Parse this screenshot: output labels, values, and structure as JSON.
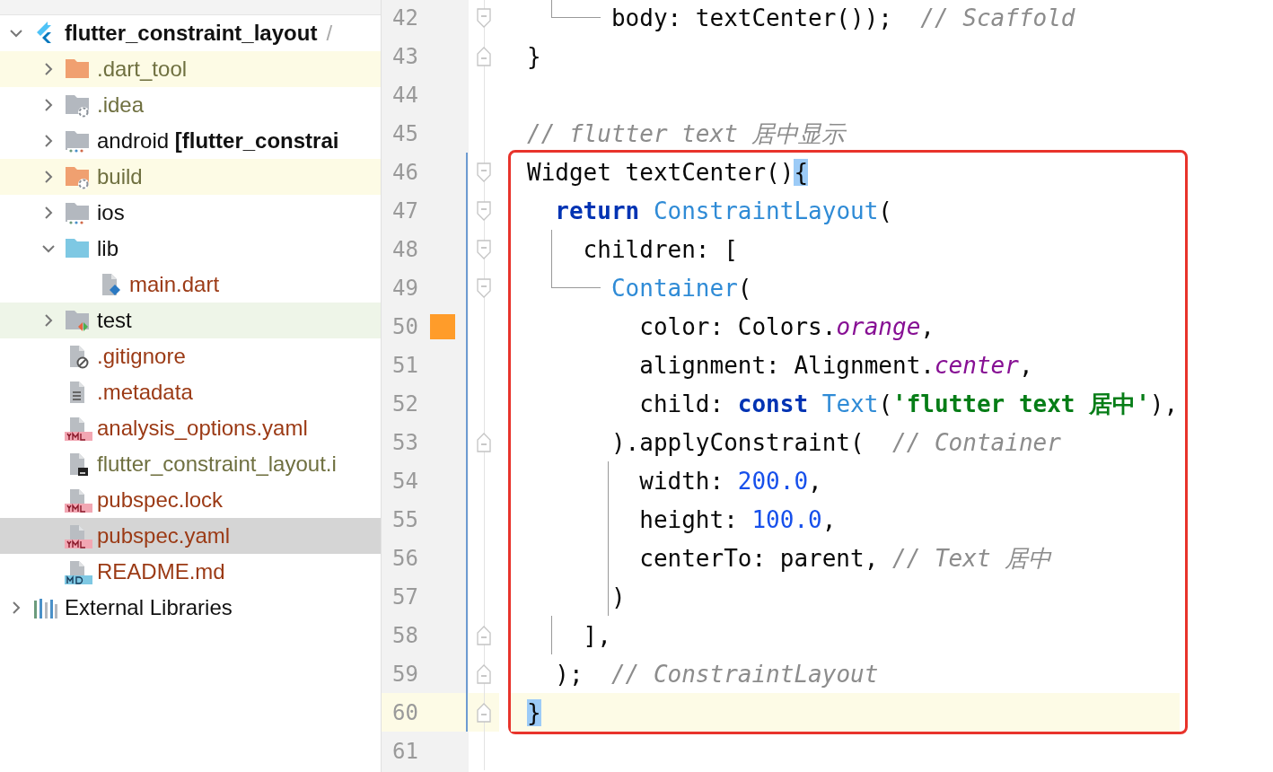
{
  "project_tree": {
    "items": [
      {
        "kind": "project",
        "label": "**flutter_constraint_layout**",
        "path": "/",
        "expanded": true,
        "selected": false,
        "children": [
          {
            "kind": "folder",
            "label": ".dart_tool",
            "excluded": true,
            "ignored": true,
            "expanded": false,
            "selected": false
          },
          {
            "kind": "config",
            "label": ".idea",
            "excluded": false,
            "ignored": true,
            "expanded": false,
            "selected": false
          },
          {
            "kind": "module",
            "label": "android **[flutter_constrai**",
            "excluded": false,
            "expanded": false,
            "selected": false
          },
          {
            "kind": "config",
            "label": "build",
            "excluded": true,
            "ignored": true,
            "expanded": false,
            "selected": false
          },
          {
            "kind": "module",
            "label": "ios",
            "excluded": false,
            "expanded": false,
            "selected": false
          },
          {
            "kind": "source",
            "label": "lib",
            "excluded": false,
            "expanded": true,
            "selected": false,
            "children": [
              {
                "kind": "dart",
                "label": "main.dart",
                "unversioned": true,
                "selected": false
              }
            ]
          },
          {
            "kind": "test",
            "label": "test",
            "excluded": false,
            "expanded": false,
            "selected": false
          },
          {
            "kind": "ignore",
            "label": ".gitignore",
            "unversioned": true,
            "selected": false
          },
          {
            "kind": "text",
            "label": ".metadata",
            "unversioned": true,
            "selected": false
          },
          {
            "kind": "yaml",
            "label": "analysis_options.yaml",
            "unversioned": true,
            "selected": false
          },
          {
            "kind": "iml",
            "label": "flutter_constraint_layout.i",
            "ignored": true,
            "selected": false
          },
          {
            "kind": "yaml",
            "label": "pubspec.lock",
            "unversioned": true,
            "selected": false
          },
          {
            "kind": "yaml",
            "label": "pubspec.yaml",
            "unversioned": true,
            "selected": true
          },
          {
            "kind": "markdown",
            "label": "README.md",
            "unversioned": true,
            "selected": false
          }
        ]
      },
      {
        "kind": "libraries",
        "label": "External Libraries",
        "expanded": false,
        "selected": false
      }
    ]
  },
  "editor": {
    "lines": [
      {
        "number": "42",
        "fold_start": true,
        "branch": true,
        "tokens": [
          {
            "kind": "plain",
            "text": "      body: textCenter());  "
          },
          {
            "kind": "comment",
            "text": "// Scaffold"
          }
        ]
      },
      {
        "number": "43",
        "fold_end": true,
        "tokens": [
          {
            "kind": "plain",
            "text": "}"
          }
        ]
      },
      {
        "number": "44"
      },
      {
        "number": "45",
        "tokens": [
          {
            "kind": "comment",
            "text": "// flutter text 居中显示"
          }
        ]
      },
      {
        "number": "46",
        "fold_start": true,
        "modified": true,
        "boxed": true,
        "tokens": [
          {
            "kind": "plain",
            "text": "Widget textCenter()"
          },
          {
            "kind": "brace",
            "text": "{"
          }
        ]
      },
      {
        "number": "47",
        "fold_start": true,
        "modified": true,
        "boxed": true,
        "tokens": [
          {
            "kind": "keyword",
            "text": "  return"
          },
          {
            "kind": "class",
            "text": " ConstraintLayout"
          },
          {
            "kind": "plain",
            "text": "("
          }
        ]
      },
      {
        "number": "48",
        "fold_start": true,
        "modified": true,
        "boxed": true,
        "outer_guide": true,
        "tokens": [
          {
            "kind": "plain",
            "text": "    children: ["
          }
        ]
      },
      {
        "number": "49",
        "fold_start": true,
        "modified": true,
        "boxed": true,
        "branch": true,
        "tokens": [
          {
            "kind": "class",
            "text": "      Container"
          },
          {
            "kind": "plain",
            "text": "("
          }
        ]
      },
      {
        "number": "50",
        "color": "#ff9c2a",
        "modified": true,
        "boxed": true,
        "tokens": [
          {
            "kind": "plain",
            "text": "        color: Colors."
          },
          {
            "kind": "field",
            "text": "orange"
          },
          {
            "kind": "plain",
            "text": ","
          }
        ]
      },
      {
        "number": "51",
        "modified": true,
        "boxed": true,
        "tokens": [
          {
            "kind": "plain",
            "text": "        alignment: Alignment."
          },
          {
            "kind": "field",
            "text": "center"
          },
          {
            "kind": "plain",
            "text": ","
          }
        ]
      },
      {
        "number": "52",
        "modified": true,
        "boxed": true,
        "tokens": [
          {
            "kind": "plain",
            "text": "        child: "
          },
          {
            "kind": "keyword",
            "text": "const"
          },
          {
            "kind": "class",
            "text": " Text"
          },
          {
            "kind": "plain",
            "text": "("
          },
          {
            "kind": "string",
            "text": "'flutter text 居中'"
          },
          {
            "kind": "plain",
            "text": "),"
          }
        ]
      },
      {
        "number": "53",
        "fold_end": true,
        "modified": true,
        "boxed": true,
        "tokens": [
          {
            "kind": "plain",
            "text": "      ).applyConstraint(  "
          },
          {
            "kind": "comment",
            "text": "// Container"
          }
        ]
      },
      {
        "number": "54",
        "modified": true,
        "boxed": true,
        "inner_guide": true,
        "tokens": [
          {
            "kind": "plain",
            "text": "        width: "
          },
          {
            "kind": "number",
            "text": "200.0"
          },
          {
            "kind": "plain",
            "text": ","
          }
        ]
      },
      {
        "number": "55",
        "modified": true,
        "boxed": true,
        "inner_guide": true,
        "tokens": [
          {
            "kind": "plain",
            "text": "        height: "
          },
          {
            "kind": "number",
            "text": "100.0"
          },
          {
            "kind": "plain",
            "text": ","
          }
        ]
      },
      {
        "number": "56",
        "modified": true,
        "boxed": true,
        "inner_guide": true,
        "tokens": [
          {
            "kind": "plain",
            "text": "        centerTo: parent, "
          },
          {
            "kind": "comment",
            "text": "// Text 居中"
          }
        ]
      },
      {
        "number": "57",
        "modified": true,
        "boxed": true,
        "inner_guide": true,
        "tokens": [
          {
            "kind": "plain",
            "text": "      )"
          }
        ]
      },
      {
        "number": "58",
        "fold_end": true,
        "modified": true,
        "boxed": true,
        "outer_guide": true,
        "tokens": [
          {
            "kind": "plain",
            "text": "    ],"
          }
        ]
      },
      {
        "number": "59",
        "fold_end": true,
        "modified": true,
        "boxed": true,
        "tokens": [
          {
            "kind": "plain",
            "text": "  );  "
          },
          {
            "kind": "comment",
            "text": "// ConstraintLayout"
          }
        ]
      },
      {
        "number": "60",
        "fold_end": true,
        "modified": true,
        "boxed": true,
        "current": true,
        "tokens": [
          {
            "kind": "brace",
            "text": "}"
          }
        ]
      },
      {
        "number": "61"
      }
    ]
  }
}
